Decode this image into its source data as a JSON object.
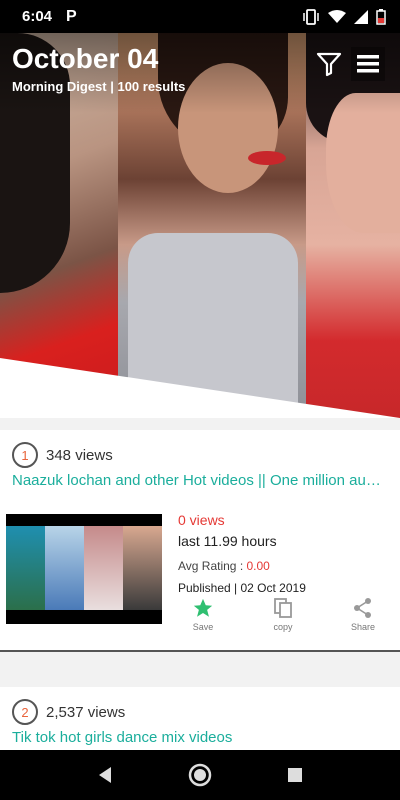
{
  "status_bar": {
    "time": "6:04",
    "app_badge": "P"
  },
  "hero": {
    "title": "October 04",
    "subtitle": "Morning Digest | 100 results"
  },
  "cards": [
    {
      "rank": "1",
      "views": "348 views",
      "title": "Naazuk lochan and other Hot videos || One million au…",
      "view_count": "0 views",
      "last": "last 11.99 hours",
      "avg_rating_label": "Avg Rating : ",
      "avg_rating_value": "0.00",
      "published_label": "Published | ",
      "published_date": "02 Oct 2019",
      "actions": {
        "save": "Save",
        "copy": "copy",
        "share": "Share"
      }
    },
    {
      "rank": "2",
      "views": "2,537 views",
      "title": "Tik tok hot girls dance mix videos"
    }
  ],
  "colors": {
    "accent_teal": "#1bae9c",
    "rank_orange": "#e8643c",
    "alert_red": "#e53935",
    "save_green": "#2fbf71"
  },
  "icons": [
    "filter-icon",
    "menu-icon",
    "star-icon",
    "copy-icon",
    "share-icon",
    "back-icon",
    "home-icon",
    "recents-icon"
  ]
}
